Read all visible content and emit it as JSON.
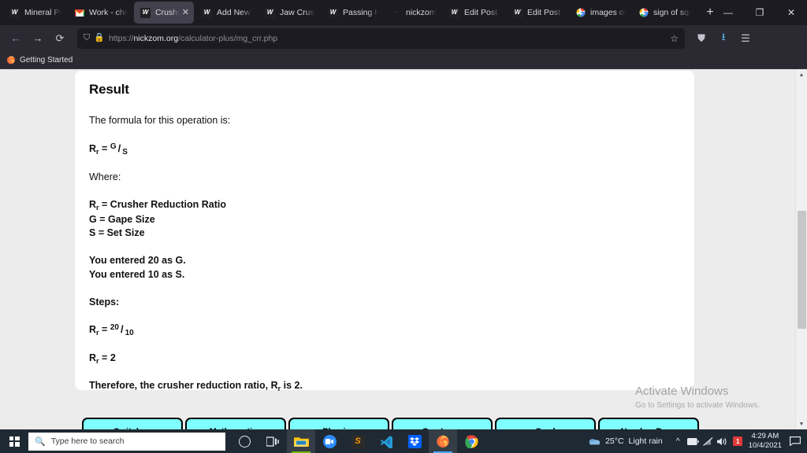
{
  "browser": {
    "tabs": [
      {
        "title": "Mineral Pro",
        "icon": "wordpress-icon",
        "active": false
      },
      {
        "title": "Work - chid",
        "icon": "gmail-icon",
        "active": false
      },
      {
        "title": "Crusher R",
        "icon": "wordpress-icon",
        "active": true
      },
      {
        "title": "Add New P",
        "icon": "wordpress-icon",
        "active": false
      },
      {
        "title": "Jaw Crushe",
        "icon": "wordpress-icon",
        "active": false
      },
      {
        "title": "Passing Re",
        "icon": "wordpress-icon",
        "active": false
      },
      {
        "title": "nickzom.or",
        "icon": "dot-icon",
        "active": false
      },
      {
        "title": "Edit Post ‹ N",
        "icon": "wordpress-icon",
        "active": false
      },
      {
        "title": "Edit Post ‹ N",
        "icon": "wordpress-icon",
        "active": false
      },
      {
        "title": "images of p",
        "icon": "google-icon",
        "active": false
      },
      {
        "title": "sign of squa",
        "icon": "google-icon",
        "active": false
      }
    ],
    "new_tab_label": "+",
    "window_controls": {
      "minimize": "—",
      "maximize": "❐",
      "close": "✕"
    },
    "nav": {
      "back": "←",
      "forward": "→",
      "reload": "⟳"
    },
    "url": {
      "scheme": "https://",
      "host": "nickzom.org",
      "path": "/calculator-plus/mg_crr.php"
    },
    "url_icons": {
      "shield": "shield-icon",
      "lock": "lock-icon",
      "bookmark": "star-icon"
    },
    "toolbar_right": {
      "pocket": "pocket-icon",
      "downloads": "download-icon",
      "menu": "hamburger-menu-icon"
    },
    "bookmarks": [
      {
        "label": "Getting Started",
        "icon": "firefox-icon"
      }
    ]
  },
  "page": {
    "heading": "Result",
    "formula_intro": "The formula for this operation is:",
    "formula": {
      "lhs": "R",
      "lhs_sub": "r",
      "eq": "=",
      "numerator": "G",
      "slash": "/",
      "denominator": "S"
    },
    "where_label": "Where:",
    "definitions": [
      {
        "symbol": "R",
        "sub": "r",
        "text": " = Crusher Reduction Ratio"
      },
      {
        "symbol": "G",
        "sub": "",
        "text": " = Gape Size"
      },
      {
        "symbol": "S",
        "sub": "",
        "text": " = Set Size"
      }
    ],
    "entered": [
      "You entered 20 as G.",
      "You entered 10 as S."
    ],
    "steps_label": "Steps:",
    "step_formula": {
      "lhs": "R",
      "lhs_sub": "r",
      "eq": "=",
      "numerator": "20",
      "slash": "/",
      "denominator": "10"
    },
    "step_result": {
      "lhs": "R",
      "lhs_sub": "r",
      "eq": "=",
      "value": "2"
    },
    "conclusion": {
      "pre": "Therefore, the crusher reduction ratio, R",
      "sub": "r",
      "mid": " is ",
      "value": "2",
      "post": "."
    },
    "category_buttons": [
      {
        "label": "Switches"
      },
      {
        "label": "Mathematics"
      },
      {
        "label": "Physics"
      },
      {
        "label": "Gas Laws"
      },
      {
        "label": "Surd"
      },
      {
        "label": "Number Base"
      }
    ],
    "button_color": "#7FFFFF",
    "watermark": {
      "line1": "Activate Windows",
      "line2": "Go to Settings to activate Windows."
    }
  },
  "taskbar": {
    "search_placeholder": "Type here to search",
    "icons": [
      {
        "name": "cortana-icon",
        "glyph": "◯"
      },
      {
        "name": "task-view-icon",
        "glyph": "❏"
      },
      {
        "name": "file-explorer-icon",
        "glyph": "▭"
      },
      {
        "name": "zoom-icon",
        "glyph": "▣"
      },
      {
        "name": "sublime-text-icon",
        "glyph": "S"
      },
      {
        "name": "vs-code-icon",
        "glyph": "✕"
      },
      {
        "name": "dropbox-icon",
        "glyph": "▼"
      },
      {
        "name": "firefox-icon",
        "glyph": "●"
      },
      {
        "name": "chrome-icon",
        "glyph": "◉"
      }
    ],
    "weather": {
      "temperature": "25°C",
      "condition": "Light rain"
    },
    "tray": {
      "chevron": "^",
      "battery": "▭",
      "wifi": "◣",
      "volume": "◀))",
      "calendar": "1"
    },
    "clock": {
      "time": "4:29 AM",
      "date": "10/4/2021"
    },
    "notification": "▢"
  }
}
